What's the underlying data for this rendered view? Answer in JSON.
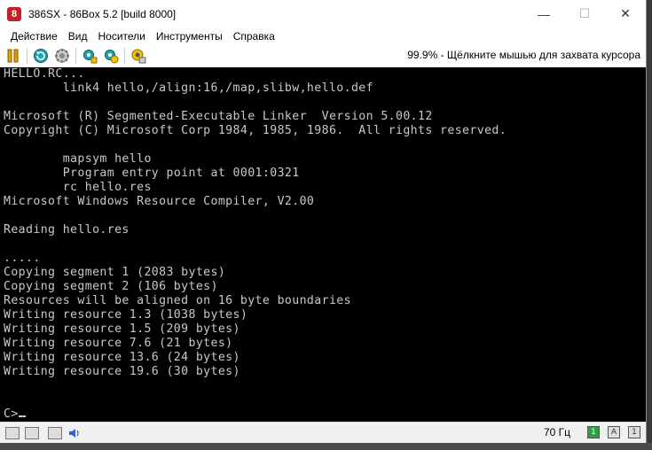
{
  "window": {
    "title": "386SX - 86Box 5.2 [build 8000]",
    "minimize": "—",
    "maximize": "☐",
    "close": "✕"
  },
  "menu": {
    "items": [
      "Действие",
      "Вид",
      "Носители",
      "Инструменты",
      "Справка"
    ]
  },
  "toolbar": {
    "icons": [
      "pause-icon",
      "reset-icon",
      "ctrl-alt-del-icon",
      "settings-icon",
      "hard-reset-icon",
      "screenshot-icon"
    ],
    "status_hint": "99.9% - Щёлкните мышью для захвата курсора"
  },
  "console": {
    "lines": [
      "HELLO.RC...",
      "        link4 hello,/align:16,/map,slibw,hello.def",
      "",
      "Microsoft (R) Segmented-Executable Linker  Version 5.00.12",
      "Copyright (C) Microsoft Corp 1984, 1985, 1986.  All rights reserved.",
      "",
      "        mapsym hello",
      "        Program entry point at 0001:0321",
      "        rc hello.res",
      "Microsoft Windows Resource Compiler, V2.00",
      "",
      "Reading hello.res",
      "",
      ".....",
      "Copying segment 1 (2083 bytes)",
      "Copying segment 2 (106 bytes)",
      "Resources will be aligned on 16 byte boundaries",
      "Writing resource 1.3 (1038 bytes)",
      "Writing resource 1.5 (209 bytes)",
      "Writing resource 7.6 (21 bytes)",
      "Writing resource 13.6 (24 bytes)",
      "Writing resource 19.6 (30 bytes)",
      "",
      ""
    ],
    "prompt": "C>"
  },
  "statusbar": {
    "fps": "70 Гц",
    "led_num": "1",
    "led_caps": "A",
    "led_scroll": "1"
  }
}
